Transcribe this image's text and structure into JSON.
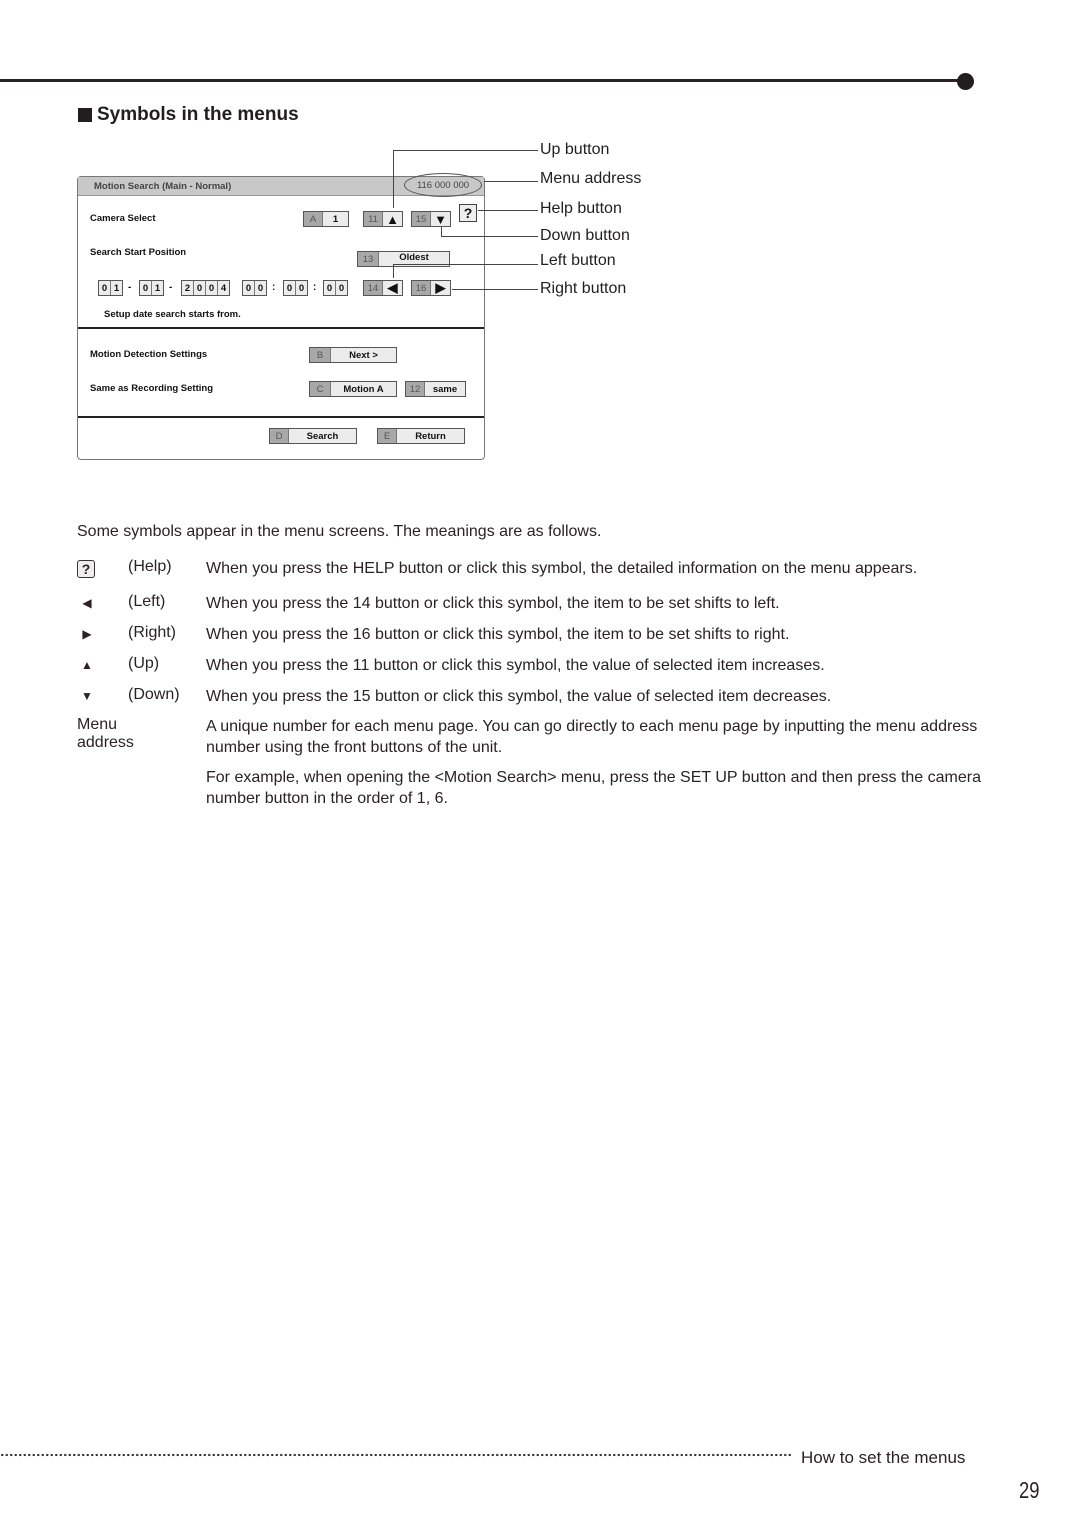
{
  "section_title": "Symbols in the menus",
  "menu_screen": {
    "title": "Motion Search (Main - Normal)",
    "address": "116 000 000",
    "camera_select": {
      "label": "Camera Select",
      "key": "A",
      "value": "1"
    },
    "up_button": {
      "key": "11",
      "symbol": "▲"
    },
    "down_button": {
      "key": "15",
      "symbol": "▼"
    },
    "help_button": "?",
    "search_start": {
      "label": "Search Start Position",
      "key": "13",
      "value": "Oldest"
    },
    "date": {
      "day": [
        "0",
        "1"
      ],
      "month": [
        "0",
        "1"
      ],
      "year": [
        "2",
        "0",
        "0",
        "4"
      ],
      "hour": [
        "0",
        "0"
      ],
      "minute": [
        "0",
        "0"
      ],
      "second": [
        "0",
        "0"
      ],
      "date_sep": "-",
      "time_sep": ":"
    },
    "left_button": {
      "key": "14",
      "symbol": "◀"
    },
    "right_button": {
      "key": "16",
      "symbol": "▶"
    },
    "hint": "Setup date search starts from.",
    "motion_detection": {
      "label": "Motion Detection Settings",
      "key": "B",
      "value": "Next >"
    },
    "same_as_recording": {
      "label": "Same as Recording Setting",
      "key": "C",
      "value": "Motion A",
      "key2": "12",
      "value2": "same"
    },
    "search": {
      "key": "D",
      "value": "Search"
    },
    "return": {
      "key": "E",
      "value": "Return"
    }
  },
  "callouts": [
    "Up button",
    "Menu address",
    "Help button",
    "Down button",
    "Left button",
    "Right button"
  ],
  "intro": "Some symbols appear in the menu screens. The meanings are as follows.",
  "symbols": [
    {
      "icon": "help-icon",
      "glyph": "?",
      "name": "(Help)",
      "desc": "When you press the HELP button or click this symbol, the detailed information on the menu appears."
    },
    {
      "icon": "left-arrow-icon",
      "glyph": "◀",
      "name": "(Left)",
      "desc": "When you press the 14 button or click this symbol, the item to be set shifts to left."
    },
    {
      "icon": "right-arrow-icon",
      "glyph": "▶",
      "name": "(Right)",
      "desc": "When you press the 16 button or click this symbol, the item to be set shifts to right."
    },
    {
      "icon": "up-arrow-icon",
      "glyph": "▲",
      "name": "(Up)",
      "desc": "When you press the 11 button or click this symbol, the value of selected item increases."
    },
    {
      "icon": "down-arrow-icon",
      "glyph": "▼",
      "name": "(Down)",
      "desc": "When you press the 15 button or click this symbol, the value of selected item decreases."
    }
  ],
  "menu_address": {
    "term": "Menu address",
    "desc1": "A unique number for each menu page. You can go directly to each menu page by inputting the menu address number using the front buttons of the unit.",
    "desc2": "For example, when opening the <Motion Search> menu, press the SET UP button and then press the camera number button in the order of 1, 6."
  },
  "footer": {
    "section": "How to set the menus",
    "page_number": "29"
  }
}
